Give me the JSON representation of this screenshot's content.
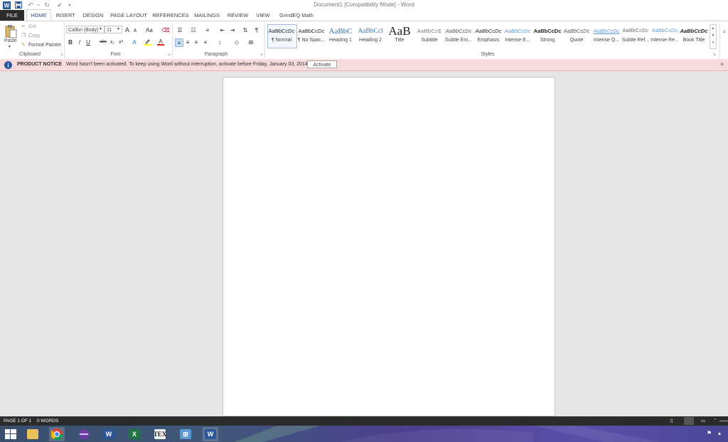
{
  "window": {
    "title": "Document1 [Compatibility Mode] - Word"
  },
  "qat": {
    "save_icon": "save-icon",
    "undo_icon": "undo-icon",
    "redo_icon": "redo-icon",
    "customize_icon": "customize-icon"
  },
  "tabs": [
    {
      "label": "FILE"
    },
    {
      "label": "HOME"
    },
    {
      "label": "INSERT"
    },
    {
      "label": "DESIGN"
    },
    {
      "label": "PAGE LAYOUT"
    },
    {
      "label": "REFERENCES"
    },
    {
      "label": "MAILINGS"
    },
    {
      "label": "REVIEW"
    },
    {
      "label": "VIEW"
    },
    {
      "label": "GrindEQ Math"
    }
  ],
  "clipboard": {
    "paste": "Paste",
    "cut": "Cut",
    "copy": "Copy",
    "format_painter": "Format Painter",
    "group": "Clipboard"
  },
  "font": {
    "family": "Calibri (Body)",
    "size": "11",
    "group": "Font",
    "grow": "A",
    "shrink": "A",
    "case": "Aa",
    "bold": "B",
    "italic": "I",
    "underline": "U",
    "strike": "abc",
    "subscript": "x₂",
    "superscript": "x²"
  },
  "paragraph": {
    "group": "Paragraph"
  },
  "styles": {
    "group": "Styles",
    "items": [
      {
        "preview": "AaBbCcDc",
        "name": "¶ Normal"
      },
      {
        "preview": "AaBbCcDc",
        "name": "¶ No Spac..."
      },
      {
        "preview": "AaBbC",
        "name": "Heading 1"
      },
      {
        "preview": "AaBbCcl",
        "name": "Heading 2"
      },
      {
        "preview": "AaB",
        "name": "Title"
      },
      {
        "preview": "AaBbCcE",
        "name": "Subtitle"
      },
      {
        "preview": "AaBbCcDc",
        "name": "Subtle Em..."
      },
      {
        "preview": "AaBbCcDc",
        "name": "Emphasis"
      },
      {
        "preview": "AaBbCcDc",
        "name": "Intense E..."
      },
      {
        "preview": "AaBbCcDc",
        "name": "Strong"
      },
      {
        "preview": "AaBbCcDc",
        "name": "Quote"
      },
      {
        "preview": "AaBbCcDc",
        "name": "Intense Q..."
      },
      {
        "preview": "AaBbCcDc",
        "name": "Subtle Ref..."
      },
      {
        "preview": "AaBbCcDc",
        "name": "Intense Re..."
      },
      {
        "preview": "AaBbCcDc",
        "name": "Book Title"
      }
    ]
  },
  "notice": {
    "label": "PRODUCT NOTICE",
    "message": "Word hasn't been activated. To keep using Word without interruption, activate before Friday, January 03, 2014.",
    "button": "Activate"
  },
  "status": {
    "page": "PAGE 1 OF 1",
    "words": "0 WORDS"
  },
  "taskbar": {
    "items": [
      {
        "icon": "start-icon"
      },
      {
        "icon": "file-explorer-icon"
      },
      {
        "icon": "chrome-icon"
      },
      {
        "icon": "app-circle-icon"
      },
      {
        "icon": "word-icon"
      },
      {
        "icon": "excel-icon"
      },
      {
        "icon": "tex-icon"
      },
      {
        "icon": "network-icon"
      },
      {
        "icon": "word-active-icon"
      }
    ]
  },
  "colors": {
    "accent": "#2b579a",
    "notice_bg": "#f7dada",
    "status_bar": "#2b2b2b"
  }
}
